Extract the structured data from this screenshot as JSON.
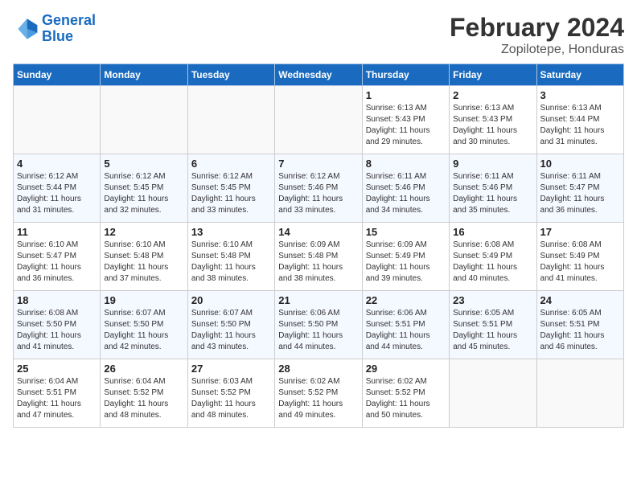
{
  "header": {
    "logo_line1": "General",
    "logo_line2": "Blue",
    "title": "February 2024",
    "subtitle": "Zopilotepe, Honduras"
  },
  "days_of_week": [
    "Sunday",
    "Monday",
    "Tuesday",
    "Wednesday",
    "Thursday",
    "Friday",
    "Saturday"
  ],
  "weeks": [
    [
      {
        "day": "",
        "info": "",
        "empty": true
      },
      {
        "day": "",
        "info": "",
        "empty": true
      },
      {
        "day": "",
        "info": "",
        "empty": true
      },
      {
        "day": "",
        "info": "",
        "empty": true
      },
      {
        "day": "1",
        "info": "Sunrise: 6:13 AM\nSunset: 5:43 PM\nDaylight: 11 hours\nand 29 minutes.",
        "empty": false
      },
      {
        "day": "2",
        "info": "Sunrise: 6:13 AM\nSunset: 5:43 PM\nDaylight: 11 hours\nand 30 minutes.",
        "empty": false
      },
      {
        "day": "3",
        "info": "Sunrise: 6:13 AM\nSunset: 5:44 PM\nDaylight: 11 hours\nand 31 minutes.",
        "empty": false
      }
    ],
    [
      {
        "day": "4",
        "info": "Sunrise: 6:12 AM\nSunset: 5:44 PM\nDaylight: 11 hours\nand 31 minutes.",
        "empty": false
      },
      {
        "day": "5",
        "info": "Sunrise: 6:12 AM\nSunset: 5:45 PM\nDaylight: 11 hours\nand 32 minutes.",
        "empty": false
      },
      {
        "day": "6",
        "info": "Sunrise: 6:12 AM\nSunset: 5:45 PM\nDaylight: 11 hours\nand 33 minutes.",
        "empty": false
      },
      {
        "day": "7",
        "info": "Sunrise: 6:12 AM\nSunset: 5:46 PM\nDaylight: 11 hours\nand 33 minutes.",
        "empty": false
      },
      {
        "day": "8",
        "info": "Sunrise: 6:11 AM\nSunset: 5:46 PM\nDaylight: 11 hours\nand 34 minutes.",
        "empty": false
      },
      {
        "day": "9",
        "info": "Sunrise: 6:11 AM\nSunset: 5:46 PM\nDaylight: 11 hours\nand 35 minutes.",
        "empty": false
      },
      {
        "day": "10",
        "info": "Sunrise: 6:11 AM\nSunset: 5:47 PM\nDaylight: 11 hours\nand 36 minutes.",
        "empty": false
      }
    ],
    [
      {
        "day": "11",
        "info": "Sunrise: 6:10 AM\nSunset: 5:47 PM\nDaylight: 11 hours\nand 36 minutes.",
        "empty": false
      },
      {
        "day": "12",
        "info": "Sunrise: 6:10 AM\nSunset: 5:48 PM\nDaylight: 11 hours\nand 37 minutes.",
        "empty": false
      },
      {
        "day": "13",
        "info": "Sunrise: 6:10 AM\nSunset: 5:48 PM\nDaylight: 11 hours\nand 38 minutes.",
        "empty": false
      },
      {
        "day": "14",
        "info": "Sunrise: 6:09 AM\nSunset: 5:48 PM\nDaylight: 11 hours\nand 38 minutes.",
        "empty": false
      },
      {
        "day": "15",
        "info": "Sunrise: 6:09 AM\nSunset: 5:49 PM\nDaylight: 11 hours\nand 39 minutes.",
        "empty": false
      },
      {
        "day": "16",
        "info": "Sunrise: 6:08 AM\nSunset: 5:49 PM\nDaylight: 11 hours\nand 40 minutes.",
        "empty": false
      },
      {
        "day": "17",
        "info": "Sunrise: 6:08 AM\nSunset: 5:49 PM\nDaylight: 11 hours\nand 41 minutes.",
        "empty": false
      }
    ],
    [
      {
        "day": "18",
        "info": "Sunrise: 6:08 AM\nSunset: 5:50 PM\nDaylight: 11 hours\nand 41 minutes.",
        "empty": false
      },
      {
        "day": "19",
        "info": "Sunrise: 6:07 AM\nSunset: 5:50 PM\nDaylight: 11 hours\nand 42 minutes.",
        "empty": false
      },
      {
        "day": "20",
        "info": "Sunrise: 6:07 AM\nSunset: 5:50 PM\nDaylight: 11 hours\nand 43 minutes.",
        "empty": false
      },
      {
        "day": "21",
        "info": "Sunrise: 6:06 AM\nSunset: 5:50 PM\nDaylight: 11 hours\nand 44 minutes.",
        "empty": false
      },
      {
        "day": "22",
        "info": "Sunrise: 6:06 AM\nSunset: 5:51 PM\nDaylight: 11 hours\nand 44 minutes.",
        "empty": false
      },
      {
        "day": "23",
        "info": "Sunrise: 6:05 AM\nSunset: 5:51 PM\nDaylight: 11 hours\nand 45 minutes.",
        "empty": false
      },
      {
        "day": "24",
        "info": "Sunrise: 6:05 AM\nSunset: 5:51 PM\nDaylight: 11 hours\nand 46 minutes.",
        "empty": false
      }
    ],
    [
      {
        "day": "25",
        "info": "Sunrise: 6:04 AM\nSunset: 5:51 PM\nDaylight: 11 hours\nand 47 minutes.",
        "empty": false
      },
      {
        "day": "26",
        "info": "Sunrise: 6:04 AM\nSunset: 5:52 PM\nDaylight: 11 hours\nand 48 minutes.",
        "empty": false
      },
      {
        "day": "27",
        "info": "Sunrise: 6:03 AM\nSunset: 5:52 PM\nDaylight: 11 hours\nand 48 minutes.",
        "empty": false
      },
      {
        "day": "28",
        "info": "Sunrise: 6:02 AM\nSunset: 5:52 PM\nDaylight: 11 hours\nand 49 minutes.",
        "empty": false
      },
      {
        "day": "29",
        "info": "Sunrise: 6:02 AM\nSunset: 5:52 PM\nDaylight: 11 hours\nand 50 minutes.",
        "empty": false
      },
      {
        "day": "",
        "info": "",
        "empty": true
      },
      {
        "day": "",
        "info": "",
        "empty": true
      }
    ]
  ]
}
